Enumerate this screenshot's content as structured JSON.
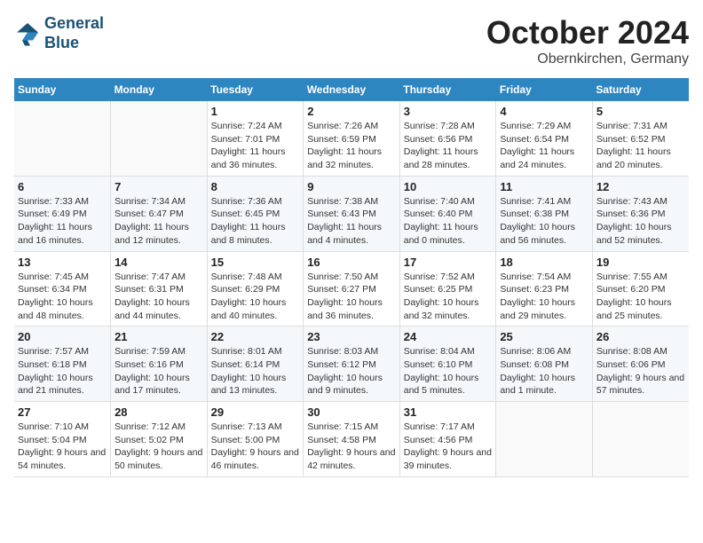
{
  "header": {
    "logo_line1": "General",
    "logo_line2": "Blue",
    "title": "October 2024",
    "subtitle": "Obernkirchen, Germany"
  },
  "weekdays": [
    "Sunday",
    "Monday",
    "Tuesday",
    "Wednesday",
    "Thursday",
    "Friday",
    "Saturday"
  ],
  "weeks": [
    [
      {
        "day": "",
        "info": ""
      },
      {
        "day": "",
        "info": ""
      },
      {
        "day": "1",
        "info": "Sunrise: 7:24 AM\nSunset: 7:01 PM\nDaylight: 11 hours and 36 minutes."
      },
      {
        "day": "2",
        "info": "Sunrise: 7:26 AM\nSunset: 6:59 PM\nDaylight: 11 hours and 32 minutes."
      },
      {
        "day": "3",
        "info": "Sunrise: 7:28 AM\nSunset: 6:56 PM\nDaylight: 11 hours and 28 minutes."
      },
      {
        "day": "4",
        "info": "Sunrise: 7:29 AM\nSunset: 6:54 PM\nDaylight: 11 hours and 24 minutes."
      },
      {
        "day": "5",
        "info": "Sunrise: 7:31 AM\nSunset: 6:52 PM\nDaylight: 11 hours and 20 minutes."
      }
    ],
    [
      {
        "day": "6",
        "info": "Sunrise: 7:33 AM\nSunset: 6:49 PM\nDaylight: 11 hours and 16 minutes."
      },
      {
        "day": "7",
        "info": "Sunrise: 7:34 AM\nSunset: 6:47 PM\nDaylight: 11 hours and 12 minutes."
      },
      {
        "day": "8",
        "info": "Sunrise: 7:36 AM\nSunset: 6:45 PM\nDaylight: 11 hours and 8 minutes."
      },
      {
        "day": "9",
        "info": "Sunrise: 7:38 AM\nSunset: 6:43 PM\nDaylight: 11 hours and 4 minutes."
      },
      {
        "day": "10",
        "info": "Sunrise: 7:40 AM\nSunset: 6:40 PM\nDaylight: 11 hours and 0 minutes."
      },
      {
        "day": "11",
        "info": "Sunrise: 7:41 AM\nSunset: 6:38 PM\nDaylight: 10 hours and 56 minutes."
      },
      {
        "day": "12",
        "info": "Sunrise: 7:43 AM\nSunset: 6:36 PM\nDaylight: 10 hours and 52 minutes."
      }
    ],
    [
      {
        "day": "13",
        "info": "Sunrise: 7:45 AM\nSunset: 6:34 PM\nDaylight: 10 hours and 48 minutes."
      },
      {
        "day": "14",
        "info": "Sunrise: 7:47 AM\nSunset: 6:31 PM\nDaylight: 10 hours and 44 minutes."
      },
      {
        "day": "15",
        "info": "Sunrise: 7:48 AM\nSunset: 6:29 PM\nDaylight: 10 hours and 40 minutes."
      },
      {
        "day": "16",
        "info": "Sunrise: 7:50 AM\nSunset: 6:27 PM\nDaylight: 10 hours and 36 minutes."
      },
      {
        "day": "17",
        "info": "Sunrise: 7:52 AM\nSunset: 6:25 PM\nDaylight: 10 hours and 32 minutes."
      },
      {
        "day": "18",
        "info": "Sunrise: 7:54 AM\nSunset: 6:23 PM\nDaylight: 10 hours and 29 minutes."
      },
      {
        "day": "19",
        "info": "Sunrise: 7:55 AM\nSunset: 6:20 PM\nDaylight: 10 hours and 25 minutes."
      }
    ],
    [
      {
        "day": "20",
        "info": "Sunrise: 7:57 AM\nSunset: 6:18 PM\nDaylight: 10 hours and 21 minutes."
      },
      {
        "day": "21",
        "info": "Sunrise: 7:59 AM\nSunset: 6:16 PM\nDaylight: 10 hours and 17 minutes."
      },
      {
        "day": "22",
        "info": "Sunrise: 8:01 AM\nSunset: 6:14 PM\nDaylight: 10 hours and 13 minutes."
      },
      {
        "day": "23",
        "info": "Sunrise: 8:03 AM\nSunset: 6:12 PM\nDaylight: 10 hours and 9 minutes."
      },
      {
        "day": "24",
        "info": "Sunrise: 8:04 AM\nSunset: 6:10 PM\nDaylight: 10 hours and 5 minutes."
      },
      {
        "day": "25",
        "info": "Sunrise: 8:06 AM\nSunset: 6:08 PM\nDaylight: 10 hours and 1 minute."
      },
      {
        "day": "26",
        "info": "Sunrise: 8:08 AM\nSunset: 6:06 PM\nDaylight: 9 hours and 57 minutes."
      }
    ],
    [
      {
        "day": "27",
        "info": "Sunrise: 7:10 AM\nSunset: 5:04 PM\nDaylight: 9 hours and 54 minutes."
      },
      {
        "day": "28",
        "info": "Sunrise: 7:12 AM\nSunset: 5:02 PM\nDaylight: 9 hours and 50 minutes."
      },
      {
        "day": "29",
        "info": "Sunrise: 7:13 AM\nSunset: 5:00 PM\nDaylight: 9 hours and 46 minutes."
      },
      {
        "day": "30",
        "info": "Sunrise: 7:15 AM\nSunset: 4:58 PM\nDaylight: 9 hours and 42 minutes."
      },
      {
        "day": "31",
        "info": "Sunrise: 7:17 AM\nSunset: 4:56 PM\nDaylight: 9 hours and 39 minutes."
      },
      {
        "day": "",
        "info": ""
      },
      {
        "day": "",
        "info": ""
      }
    ]
  ]
}
